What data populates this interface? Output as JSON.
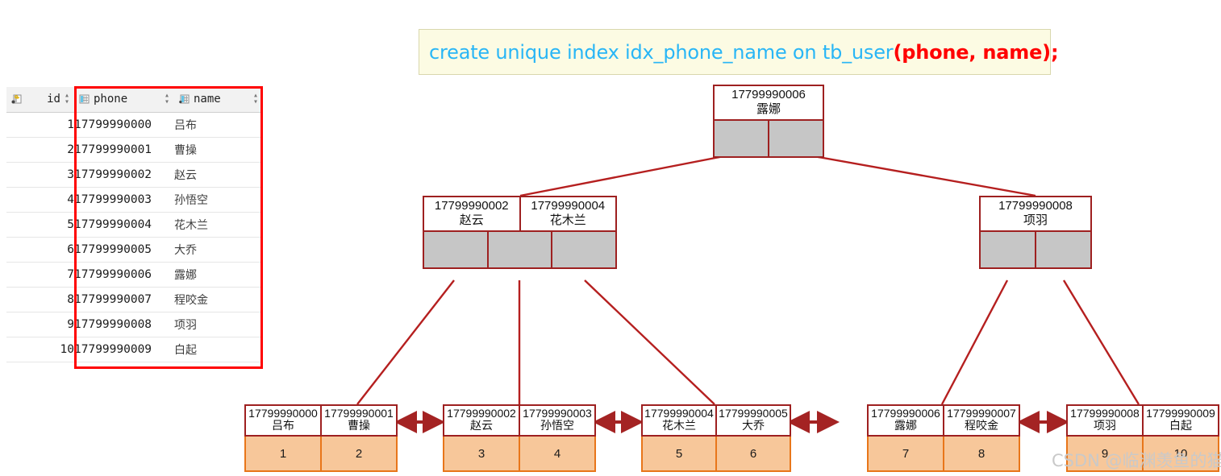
{
  "sql": {
    "prefix": "create unique index idx_phone_name on tb_user",
    "highlight": "(phone, name);"
  },
  "grid": {
    "columns": [
      {
        "key": "id",
        "label": "id",
        "icon": "primary-key-column-icon",
        "align": "right"
      },
      {
        "key": "phone",
        "label": "phone",
        "icon": "column-icon",
        "align": "left"
      },
      {
        "key": "name",
        "label": "name",
        "icon": "column-icon",
        "align": "left"
      }
    ],
    "sort_glyph": "⌃⌄",
    "rows": [
      {
        "id": "1",
        "phone": "17799990000",
        "name": "吕布"
      },
      {
        "id": "2",
        "phone": "17799990001",
        "name": "曹操"
      },
      {
        "id": "3",
        "phone": "17799990002",
        "name": "赵云"
      },
      {
        "id": "4",
        "phone": "17799990003",
        "name": "孙悟空"
      },
      {
        "id": "5",
        "phone": "17799990004",
        "name": "花木兰"
      },
      {
        "id": "6",
        "phone": "17799990005",
        "name": "大乔"
      },
      {
        "id": "7",
        "phone": "17799990006",
        "name": "露娜"
      },
      {
        "id": "8",
        "phone": "17799990007",
        "name": "程咬金"
      },
      {
        "id": "9",
        "phone": "17799990008",
        "name": "项羽"
      },
      {
        "id": "10",
        "phone": "17799990009",
        "name": "白起"
      }
    ]
  },
  "tree": {
    "root": {
      "keys": [
        {
          "phone": "17799990006",
          "name": "露娜"
        }
      ],
      "pointer_count": 2
    },
    "internal": [
      {
        "keys": [
          {
            "phone": "17799990002",
            "name": "赵云"
          },
          {
            "phone": "17799990004",
            "name": "花木兰"
          }
        ],
        "pointer_count": 3
      },
      {
        "keys": [
          {
            "phone": "17799990008",
            "name": "项羽"
          }
        ],
        "pointer_count": 2
      }
    ],
    "leaves": [
      {
        "entries": [
          {
            "phone": "17799990000",
            "name": "吕布",
            "id": "1"
          },
          {
            "phone": "17799990001",
            "name": "曹操",
            "id": "2"
          }
        ]
      },
      {
        "entries": [
          {
            "phone": "17799990002",
            "name": "赵云",
            "id": "3"
          },
          {
            "phone": "17799990003",
            "name": "孙悟空",
            "id": "4"
          }
        ]
      },
      {
        "entries": [
          {
            "phone": "17799990004",
            "name": "花木兰",
            "id": "5"
          },
          {
            "phone": "17799990005",
            "name": "大乔",
            "id": "6"
          }
        ]
      },
      {
        "entries": [
          {
            "phone": "17799990006",
            "name": "露娜",
            "id": "7"
          },
          {
            "phone": "17799990007",
            "name": "程咬金",
            "id": "8"
          }
        ]
      },
      {
        "entries": [
          {
            "phone": "17799990008",
            "name": "项羽",
            "id": "9"
          },
          {
            "phone": "17799990009",
            "name": "白起",
            "id": "10"
          }
        ]
      }
    ]
  },
  "colors": {
    "node_border": "#9e2020",
    "pointer_fill": "#c6c6c6",
    "leaf_fill": "#f7c79a",
    "leaf_border": "#e8761a",
    "link": "#b51f1f",
    "sql_text": "#29b6f6",
    "sql_highlight": "#ff0000",
    "grid_highlight": "#ff0000"
  },
  "watermark": {
    "text": "CSDN @临渊羡鱼的猫"
  }
}
